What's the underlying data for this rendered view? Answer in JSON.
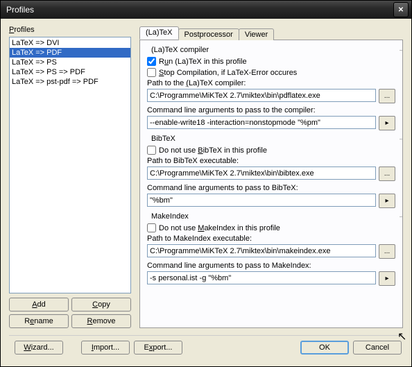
{
  "window": {
    "title": "Profiles"
  },
  "sidebar": {
    "label": "Profiles",
    "items": [
      "LaTeX => DVI",
      "LaTeX => PDF",
      "LaTeX => PS",
      "LaTeX => PS => PDF",
      "LaTeX => pst-pdf => PDF"
    ],
    "selected_index": 1,
    "buttons": {
      "add": "Add",
      "copy": "Copy",
      "rename": "Rename",
      "remove": "Remove"
    }
  },
  "tabs": {
    "t0": "(La)TeX",
    "t1": "Postprocessor",
    "t2": "Viewer",
    "active": 0
  },
  "latex": {
    "group_title": "(La)TeX compiler",
    "run_label": "Run (La)TeX in this profile",
    "run_checked": true,
    "stop_label": "Stop Compilation, if LaTeX-Error occures",
    "stop_checked": false,
    "path_label": "Path to the (La)TeX compiler:",
    "path_value": "C:\\Programme\\MiKTeX 2.7\\miktex\\bin\\pdflatex.exe",
    "args_label": "Command line arguments to pass to the compiler:",
    "args_value": "--enable-write18 -interaction=nonstopmode \"%pm\""
  },
  "bibtex": {
    "group_title": "BibTeX",
    "skip_label": "Do not use BibTeX in this profile",
    "skip_checked": false,
    "path_label": "Path to BibTeX executable:",
    "path_value": "C:\\Programme\\MiKTeX 2.7\\miktex\\bin\\bibtex.exe",
    "args_label": "Command line arguments to pass to BibTeX:",
    "args_value": "\"%bm\""
  },
  "makeindex": {
    "group_title": "MakeIndex",
    "skip_label": "Do not use MakeIndex in this profile",
    "skip_checked": false,
    "path_label": "Path to MakeIndex executable:",
    "path_value": "C:\\Programme\\MiKTeX 2.7\\miktex\\bin\\makeindex.exe",
    "args_label": "Command line arguments to pass to MakeIndex:",
    "args_value": "-s personal.ist -g \"%bm\""
  },
  "footer": {
    "wizard": "Wizard...",
    "import": "Import...",
    "export": "Export...",
    "ok": "OK",
    "cancel": "Cancel"
  },
  "icons": {
    "browse": "...",
    "expand": "▸",
    "close": "✕"
  }
}
